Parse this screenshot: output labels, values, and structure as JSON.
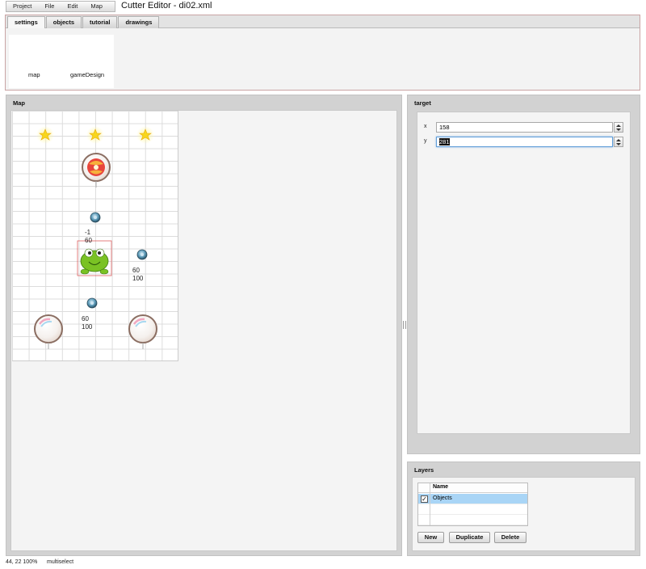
{
  "window": {
    "title": "Cutter Editor - di02.xml"
  },
  "menu": [
    "Project",
    "File",
    "Edit",
    "Map"
  ],
  "tabs": [
    "settings",
    "objects",
    "tutorial",
    "drawings"
  ],
  "settings_links": [
    "map",
    "gameDesign"
  ],
  "map_panel": {
    "title": "Map",
    "labels": {
      "candy_label_1": "-1",
      "candy_label_2": "60",
      "pump_right_1": "60",
      "pump_right_2": "100",
      "pump_low_1": "60",
      "pump_low_2": "100"
    },
    "objects": [
      "star-icon",
      "star-icon",
      "star-icon",
      "candy-bubble-icon",
      "pin-icon",
      "om-nom-icon",
      "pin-icon",
      "pin-icon",
      "bubble-icon",
      "bubble-icon"
    ]
  },
  "target_panel": {
    "title": "target",
    "x_label": "x",
    "x_value": "158",
    "y_label": "y",
    "y_value": "281"
  },
  "layers_panel": {
    "title": "Layers",
    "column_header": "Name",
    "rows": [
      {
        "name": "Objects",
        "checked": true,
        "check_glyph": "✓"
      }
    ],
    "buttons": [
      "New",
      "Duplicate",
      "Delete"
    ]
  },
  "status": {
    "coords": "44, 22 100%",
    "mode": "multiselect"
  },
  "colors": {
    "panel_bg": "#d2d2d2",
    "inner_bg": "#f4f4f4",
    "selection": "#a9d5f6",
    "focus": "#5f9dd8"
  }
}
